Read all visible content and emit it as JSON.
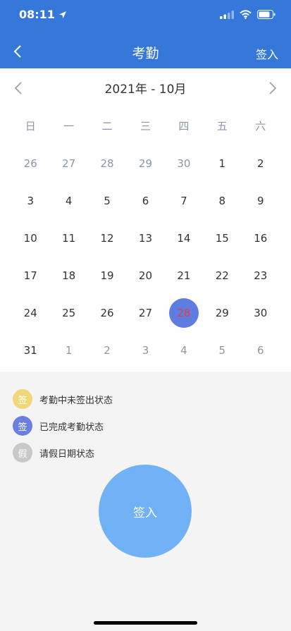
{
  "status": {
    "time": "08:11"
  },
  "nav": {
    "title": "考勤",
    "action": "签入"
  },
  "calendar": {
    "month_label": "2021年 - 10月",
    "weekdays": [
      "日",
      "一",
      "二",
      "三",
      "四",
      "五",
      "六"
    ],
    "weeks": [
      [
        {
          "d": "26",
          "other": true
        },
        {
          "d": "27",
          "other": true
        },
        {
          "d": "28",
          "other": true
        },
        {
          "d": "29",
          "other": true
        },
        {
          "d": "30",
          "other": true
        },
        {
          "d": "1"
        },
        {
          "d": "2"
        }
      ],
      [
        {
          "d": "3"
        },
        {
          "d": "4"
        },
        {
          "d": "5"
        },
        {
          "d": "6"
        },
        {
          "d": "7"
        },
        {
          "d": "8"
        },
        {
          "d": "9"
        }
      ],
      [
        {
          "d": "10"
        },
        {
          "d": "11"
        },
        {
          "d": "12"
        },
        {
          "d": "13"
        },
        {
          "d": "14"
        },
        {
          "d": "15"
        },
        {
          "d": "16"
        }
      ],
      [
        {
          "d": "17"
        },
        {
          "d": "18"
        },
        {
          "d": "19"
        },
        {
          "d": "20"
        },
        {
          "d": "21"
        },
        {
          "d": "22"
        },
        {
          "d": "23"
        }
      ],
      [
        {
          "d": "24"
        },
        {
          "d": "25"
        },
        {
          "d": "26"
        },
        {
          "d": "27"
        },
        {
          "d": "28",
          "status": "done"
        },
        {
          "d": "29"
        },
        {
          "d": "30"
        }
      ],
      [
        {
          "d": "31"
        },
        {
          "d": "1",
          "other": true
        },
        {
          "d": "2",
          "other": true
        },
        {
          "d": "3",
          "other": true
        },
        {
          "d": "4",
          "other": true
        },
        {
          "d": "5",
          "other": true
        },
        {
          "d": "6",
          "other": true
        }
      ]
    ]
  },
  "legend": [
    {
      "icon": "签",
      "text": "考勤中未签出状态",
      "color": "#f0d77a",
      "name": "pending-signout"
    },
    {
      "icon": "签",
      "text": "已完成考勤状态",
      "color": "#6c7fe0",
      "name": "completed"
    },
    {
      "icon": "假",
      "text": "请假日期状态",
      "color": "#c8c8c8",
      "name": "leave"
    }
  ],
  "signin_button": {
    "label": "签入"
  },
  "colors": {
    "header": "#3578d9",
    "accent": "#70b2f5",
    "today_text": "#e04040"
  }
}
